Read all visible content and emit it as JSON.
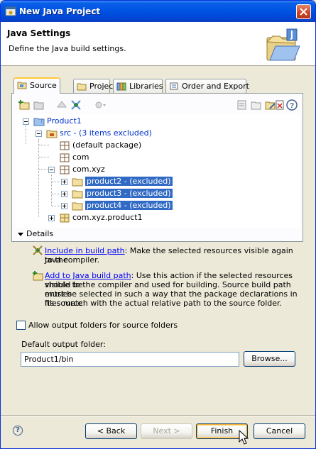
{
  "window": {
    "title": "New Java Project"
  },
  "header": {
    "title": "Java Settings",
    "description": "Define the Java build settings."
  },
  "tabs": [
    {
      "label": "Source",
      "active": true
    },
    {
      "label": "Projects",
      "active": false
    },
    {
      "label": "Libraries",
      "active": false
    },
    {
      "label": "Order and Export",
      "active": false
    }
  ],
  "tree": {
    "project": "Product1",
    "src": "src - (3 items excluded)",
    "default_package": "(default package)",
    "com": "com",
    "com_xyz": "com.xyz",
    "excluded": [
      "product2 - (excluded)",
      "product3 - (excluded)",
      "product4 - (excluded)"
    ],
    "com_xyz_product1": "com.xyz.product1"
  },
  "details": {
    "toggle_label": "Details",
    "include_link": "Include in build path",
    "include_text_1": ": Make the selected resources visible again to the",
    "include_text_2": "Java compiler.",
    "add_link": "Add to Java build path",
    "add_text_1": ": Use this action if the selected resources should be",
    "add_text_2": "visible to the compiler and used for building. Source build path entries",
    "add_text_3": "must be selected in such a way that the package declarations in its source",
    "add_text_4": "files match with the actual relative path to the source folder."
  },
  "options": {
    "allow_output_folders_label": "Allow output folders for source folders",
    "allow_output_folders_checked": false,
    "default_output_label": "Default output folder:",
    "default_output_value": "Product1/bin",
    "browse_label": "Browse..."
  },
  "buttons": {
    "back": "< Back",
    "next": "Next >",
    "finish": "Finish",
    "cancel": "Cancel"
  },
  "colors": {
    "titlebar": "#0054e3",
    "selection": "#316ac5",
    "link": "#0000ff",
    "tree_label": "#0033cc"
  }
}
